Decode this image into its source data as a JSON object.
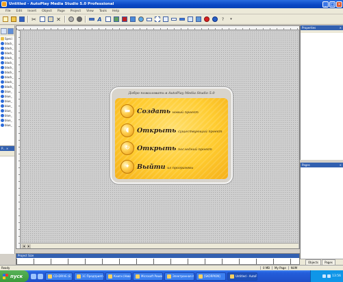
{
  "window": {
    "title": "Untitled - AutoPlay Media Studio 5.0 Professional"
  },
  "menubar": [
    "File",
    "Edit",
    "Insert",
    "Object",
    "Page",
    "Project",
    "View",
    "Tools",
    "Help"
  ],
  "left_panel": {
    "items": [
      {
        "label": "Speci",
        "icon": "folder-icon"
      },
      {
        "label": "black_",
        "icon": "object-icon"
      },
      {
        "label": "black_",
        "icon": "object-icon"
      },
      {
        "label": "black_",
        "icon": "object-icon"
      },
      {
        "label": "black_",
        "icon": "object-icon"
      },
      {
        "label": "black_",
        "icon": "object-icon"
      },
      {
        "label": "black_",
        "icon": "object-icon"
      },
      {
        "label": "black_",
        "icon": "object-icon"
      },
      {
        "label": "black_",
        "icon": "object-icon"
      },
      {
        "label": "black_",
        "icon": "object-icon"
      },
      {
        "label": "black_",
        "icon": "object-icon"
      },
      {
        "label": "blue_",
        "icon": "object-icon"
      },
      {
        "label": "blue_",
        "icon": "object-icon"
      },
      {
        "label": "blue_",
        "icon": "object-icon"
      },
      {
        "label": "blue_",
        "icon": "object-icon"
      },
      {
        "label": "blue_",
        "icon": "object-icon"
      },
      {
        "label": "blue_",
        "icon": "object-icon"
      },
      {
        "label": "blue_",
        "icon": "object-icon"
      },
      {
        "label": "blue_",
        "icon": "object-icon"
      }
    ],
    "lower_header": "P... ×"
  },
  "dialog": {
    "header": "Добро пожаловать в AutoPlay Media Studio 5.0",
    "options": [
      {
        "big": "Создать",
        "small": "новый проект",
        "icon": "folder-open-icon"
      },
      {
        "big": "Открыть",
        "small": "существующий проект",
        "icon": "open-project-icon"
      },
      {
        "big": "Открыть",
        "small": "последний проект",
        "icon": "recent-project-icon"
      },
      {
        "big": "Выйти",
        "small": "из программы",
        "icon": "exit-icon"
      }
    ]
  },
  "right_panels": {
    "properties": "Properties",
    "pages": "Pages",
    "tabs": [
      "Objects",
      "Pages"
    ]
  },
  "project_size": {
    "label": "Project Size"
  },
  "statusbar": {
    "ready": "Ready",
    "size": "0 MB",
    "page": "My Page",
    "extra": "NUM"
  },
  "taskbar": {
    "start": "пуск",
    "tasks": [
      "CD-DRIVE (E:)",
      "1С:Предприятие",
      "Книги (Новая...",
      "Microsoft PowerP...",
      "Электронная п...",
      "[SKORPION]",
      "Untitled - AutoP..."
    ],
    "clock": "13:56"
  },
  "colors": {
    "titlebar": "#0a47c4",
    "dialog_gold": "#ffcc30",
    "taskbar": "#245edb",
    "start_green": "#3a9a3a"
  }
}
